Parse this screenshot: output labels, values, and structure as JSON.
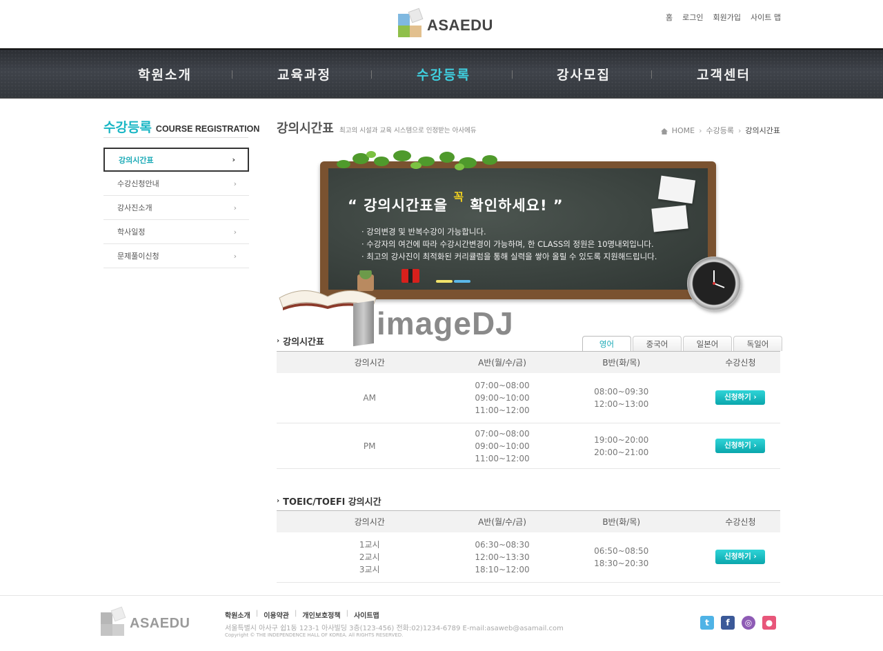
{
  "header": {
    "logo_text": "ASAEDU",
    "util_links": [
      "홈",
      "로그인",
      "회원가입",
      "사이트 맵"
    ]
  },
  "nav": {
    "items": [
      {
        "label": "학원소개"
      },
      {
        "label": "교육과정"
      },
      {
        "label": "수강등록"
      },
      {
        "label": "강사모집"
      },
      {
        "label": "고객센터"
      }
    ],
    "active_index": 2
  },
  "sidebar": {
    "title_kr": "수강등록",
    "title_en": "COURSE REGISTRATION",
    "items": [
      {
        "label": "강의시간표"
      },
      {
        "label": "수강신청안내"
      },
      {
        "label": "강사진소개"
      },
      {
        "label": "학사일정"
      },
      {
        "label": "문제풀이신청"
      }
    ],
    "active_index": 0
  },
  "page": {
    "title": "강의시간표",
    "subtitle": "최고의 시설과 교육 시스템으로 인정받는 아사에듀",
    "breadcrumb": [
      "HOME",
      "수강등록",
      "강의시간표"
    ]
  },
  "banner": {
    "headline_open": "“ 강의시간표을",
    "headline_pop": "꼭",
    "headline_close": "확인하세요! ”",
    "lines": [
      "· 강의변경 및 반복수강이 가능합니다.",
      "· 수강자의 여건에 따라 수강시간변경이 가능하며, 한 CLASS의 정원은 10명내외입니다.",
      "· 최고의 강사진이 최적화된 커리큘럼을 통해 실력을 쌓아 올릴 수 있도록 지원해드립니다."
    ],
    "watermark": "imageDJ"
  },
  "schedule": {
    "title": "강의시간표",
    "tabs": [
      "영어",
      "중국어",
      "일본어",
      "독일어"
    ],
    "active_tab": 0,
    "headers": [
      "강의시간",
      "A반(월/수/금)",
      "B반(화/목)",
      "수강신청"
    ],
    "rows": [
      {
        "period": "AM",
        "a": [
          "07:00~08:00",
          "09:00~10:00",
          "11:00~12:00"
        ],
        "b": [
          "08:00~09:30",
          "12:00~13:00"
        ],
        "button": "신청하기 ›"
      },
      {
        "period": "PM",
        "a": [
          "07:00~08:00",
          "09:00~10:00",
          "11:00~12:00"
        ],
        "b": [
          "19:00~20:00",
          "20:00~21:00"
        ],
        "button": "신청하기 ›"
      }
    ]
  },
  "toeic": {
    "title": "TOEIC/TOEFl 강의시간",
    "headers": [
      "강의시간",
      "A반(월/수/금)",
      "B반(화/목)",
      "수강신청"
    ],
    "rows": [
      {
        "period": [
          "1교시",
          "2교시",
          "3교시"
        ],
        "a": [
          "06:30~08:30",
          "12:00~13:30",
          "18:10~12:00"
        ],
        "b": [
          "06:50~08:50",
          "18:30~20:30"
        ],
        "button": "신청하기 ›"
      }
    ]
  },
  "footer": {
    "logo_text": "ASAEDU",
    "links": [
      "학원소개",
      "이용약관",
      "개인보호정책",
      "사이트맵"
    ],
    "address": "서울특별시 아사구 쉽1동 123-1 아사빌딩 3층(123-456) 전화:02)1234-6789 E-mail:asaweb@asamail.com",
    "copyright": "Copyright © THE INDEPENDENCE HALL OF KOREA. All RIGHTS RESERVED."
  },
  "colors": {
    "accent": "#19b6c4",
    "button": "#0aa6ac",
    "nav_bg": "#383c42"
  },
  "icons": [
    "twitter-icon",
    "facebook-icon",
    "podcast-icon",
    "blog-icon",
    "home-icon",
    "chevron-right-icon"
  ]
}
